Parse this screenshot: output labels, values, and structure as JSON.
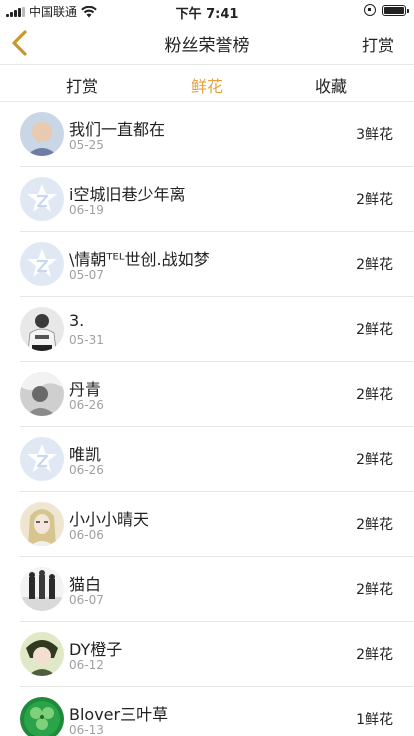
{
  "status_bar": {
    "carrier": "中国联通",
    "time": "下午 7:41"
  },
  "nav": {
    "title": "粉丝荣誉榜",
    "action_label": "打赏",
    "back_icon": "chevron-left-icon",
    "accent_color": "#c8972e"
  },
  "tabs": [
    {
      "label": "打赏",
      "active": false
    },
    {
      "label": "鲜花",
      "active": true
    },
    {
      "label": "收藏",
      "active": false
    }
  ],
  "active_tab_color": "#e8a33c",
  "fans": [
    {
      "name": "我们一直都在",
      "date": "05-25",
      "count": "3鲜花",
      "avatar": "photo-portrait"
    },
    {
      "name": "i空城旧巷少年离",
      "date": "06-19",
      "count": "2鲜花",
      "avatar": "default-star"
    },
    {
      "name": "\\情朝ᵀᴱᴸ世创.战如梦",
      "date": "05-07",
      "count": "2鲜花",
      "avatar": "default-star"
    },
    {
      "name": "3.",
      "date": "05-31",
      "count": "2鲜花",
      "avatar": "photo-person"
    },
    {
      "name": "丹青",
      "date": "06-26",
      "count": "2鲜花",
      "avatar": "photo-grey"
    },
    {
      "name": "唯凯",
      "date": "06-26",
      "count": "2鲜花",
      "avatar": "default-star"
    },
    {
      "name": "小小小晴天",
      "date": "06-06",
      "count": "2鲜花",
      "avatar": "photo-girl"
    },
    {
      "name": "猫白",
      "date": "06-07",
      "count": "2鲜花",
      "avatar": "photo-figures"
    },
    {
      "name": "DY橙子",
      "date": "06-12",
      "count": "2鲜花",
      "avatar": "photo-anime"
    },
    {
      "name": "Blover三叶草",
      "date": "06-13",
      "count": "1鲜花",
      "avatar": "photo-clover"
    }
  ]
}
